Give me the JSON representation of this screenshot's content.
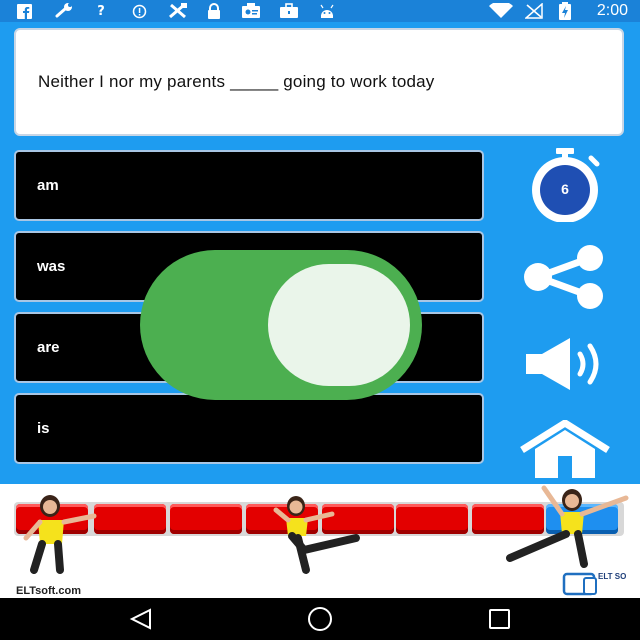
{
  "status_bar": {
    "time": "2:00",
    "icons": [
      "facebook-icon",
      "wrench-icon",
      "help-icon",
      "info-icon",
      "tools-icon",
      "lock-icon",
      "contact-icon",
      "briefcase-icon",
      "android-icon",
      "wifi-icon",
      "no-signal-icon",
      "battery-charging-icon"
    ]
  },
  "question": {
    "text": "Neither I nor my parents _____ going to work today"
  },
  "answers": [
    {
      "label": "am"
    },
    {
      "label": "was"
    },
    {
      "label": "are"
    },
    {
      "label": "is"
    }
  ],
  "timer": {
    "value": "6"
  },
  "toggle": {
    "state": "on",
    "color": "#4caf50"
  },
  "progress": {
    "total": 8,
    "current": 8
  },
  "banner": {
    "brand_left": "ELTsoft.com",
    "logo_right": "ELT SOFT"
  },
  "nav_bar": {
    "icons": [
      "back-icon",
      "home-icon",
      "recents-icon"
    ]
  },
  "colors": {
    "background": "#1e9cf0",
    "status_bar": "#1b82d8",
    "answer_bg": "#000000",
    "timer_blue": "#1f4fb3"
  }
}
